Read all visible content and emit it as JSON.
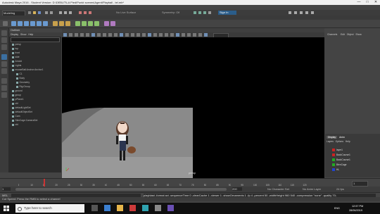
{
  "window": {
    "title": "Autodesk Maya 2016 - Student Version: D:\\DEBUT\\LA Pied\\Punkt scenes\\Agent\\Playball - tel.mb*",
    "controls": [
      "—",
      "□",
      "✕"
    ]
  },
  "menubar": [
    "File",
    "Edit",
    "Create",
    "Select",
    "Modify",
    "Display",
    "Windows",
    "Mesh",
    "Edit Mesh",
    "Mesh Tools",
    "Mesh Display",
    "Curves",
    "Surfaces",
    "Deform",
    "UV",
    "Generate",
    "Cache",
    "Substance",
    "Arnold",
    "Help"
  ],
  "status": {
    "mode": "Modeling",
    "no_live": "No Live Surface",
    "symmetry": "Symmetry: Off",
    "sign_in": "Sign In"
  },
  "shelf_tabs": [
    "Curves / Surfaces",
    "Poly Modeling",
    "Sculpting",
    "Rigging",
    "Animation",
    "Rendering",
    "FX",
    "FX Caching",
    "Custom",
    "Arnold",
    "Bifrost",
    "MASH",
    "Motion Graphics",
    "XGen"
  ],
  "shelf_active": 1,
  "outliner": {
    "title": "Outliner",
    "menu": [
      "Display",
      "Show",
      "Help"
    ],
    "items": [
      {
        "label": "persp",
        "indent": 0
      },
      {
        "label": "top",
        "indent": 0
      },
      {
        "label": "front",
        "indent": 0
      },
      {
        "label": "side",
        "indent": 0
      },
      {
        "label": "Arnold",
        "indent": 0
      },
      {
        "label": "Lights",
        "indent": 0
      },
      {
        "label": "mouseBall:Anchor:Anchor1",
        "indent": 0
      },
      {
        "label": "C1",
        "indent": 1
      },
      {
        "label": "Body",
        "indent": 1
      },
      {
        "label": "Geometry",
        "indent": 1
      },
      {
        "label": "Rig:Group",
        "indent": 1
      },
      {
        "label": "ground",
        "indent": 0
      },
      {
        "label": "group",
        "indent": 0
      },
      {
        "label": "pPlane1",
        "indent": 0
      },
      {
        "label": "ctrl",
        "indent": 0
      },
      {
        "label": "defaultLightSet",
        "indent": 0
      },
      {
        "label": "defaultObjectSet",
        "indent": 0
      },
      {
        "label": "Cam",
        "indent": 0
      },
      {
        "label": "SkinCage:CameraSet",
        "indent": 0
      },
      {
        "label": "ctrl",
        "indent": 0
      }
    ]
  },
  "viewport": {
    "menu": [
      "View",
      "Shading",
      "Lighting",
      "Show",
      "Renderer",
      "Panels"
    ],
    "camera_label": "persp"
  },
  "channelbox": {
    "menu": [
      "Channels",
      "Edit",
      "Object",
      "Show"
    ]
  },
  "layers": {
    "tabs": [
      "Display",
      "Anim"
    ],
    "menu": [
      "Layers",
      "Options",
      "Help"
    ],
    "rows": [
      {
        "label": "layer1",
        "color": "#cc2222"
      },
      {
        "label": "BackCourse1",
        "color": "#cc2222"
      },
      {
        "label": "BackCourse1",
        "color": "#22aa22"
      },
      {
        "label": "BlenCage",
        "color": "#22aa22"
      },
      {
        "label": "HL",
        "color": "#2244cc"
      }
    ]
  },
  "timeline": {
    "ticks": [
      "5",
      "10",
      "15",
      "20",
      "25",
      "30",
      "35",
      "40",
      "45",
      "50",
      "55",
      "60",
      "65",
      "70",
      "75",
      "80",
      "85",
      "90",
      "95",
      "100",
      "105",
      "110",
      "115",
      "120"
    ],
    "current_frame": "1",
    "start": "1",
    "end": "120",
    "range_start": "1",
    "range_end": "200",
    "no_char": "No Character Set",
    "no_anim": "No Anim Layer",
    "fps": "24 fps"
  },
  "cmdline": {
    "label": "MEL",
    "result": "playblast  -format avi -sequenceTime 0 -clearCache 1 -viewer 1 -showOrnaments 1 -fp 4 -percent 50 -widthHeight 960 540 -compression \"none\" -quality 70;"
  },
  "helpline": "Cut Speed: Press the RMB to select a channel",
  "taskbar": {
    "search_placeholder": "Type here to search",
    "time": "12:57 PM",
    "date": "28/06/2019",
    "lang": "ENG"
  }
}
